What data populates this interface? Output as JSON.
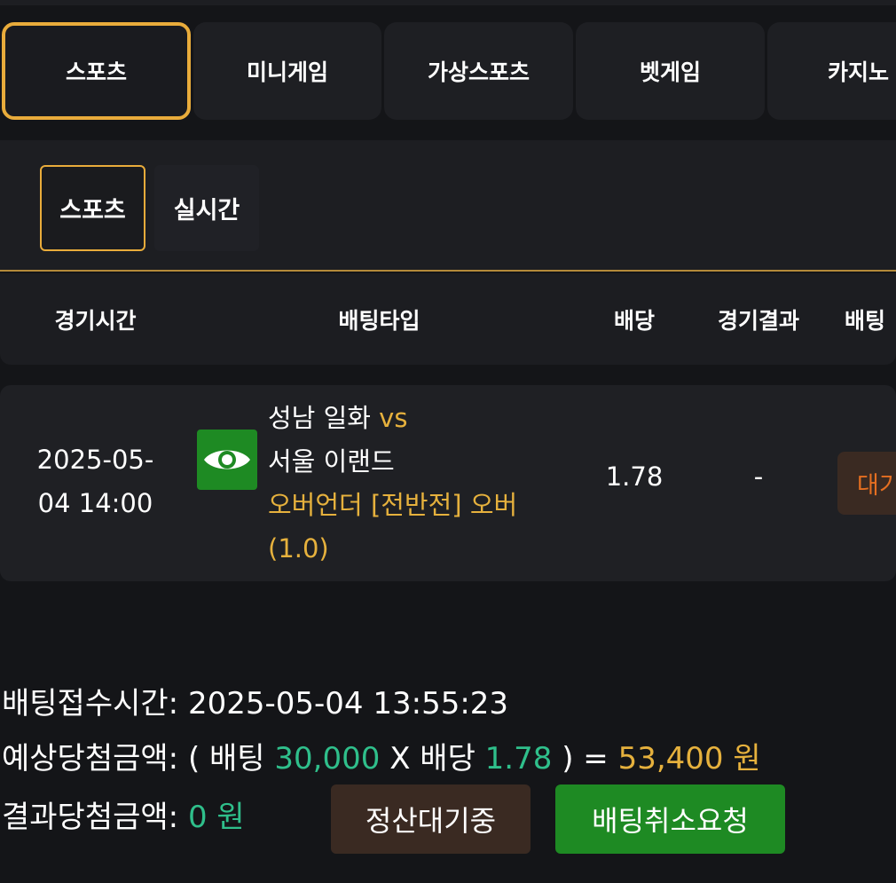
{
  "category_tabs": [
    {
      "label": "스포츠",
      "active": true
    },
    {
      "label": "미니게임",
      "active": false
    },
    {
      "label": "가상스포츠",
      "active": false
    },
    {
      "label": "벳게임",
      "active": false
    },
    {
      "label": "카지노",
      "active": false
    }
  ],
  "sub_tabs": [
    {
      "label": "스포츠",
      "active": true
    },
    {
      "label": "실시간",
      "active": false
    }
  ],
  "table": {
    "headers": [
      "경기시간",
      "배팅타입",
      "배당",
      "경기결과",
      "배팅"
    ],
    "rows": [
      {
        "time_line1": "2025-05-",
        "time_line2": "04 14:00",
        "icon": "eye-icon",
        "home": "성남 일화",
        "vs": "vs",
        "away": "서울 이랜드",
        "bet_type": "오버언더 [전반전] 오버",
        "bet_line": "(1.0)",
        "odds": "1.78",
        "result": "-",
        "status": "대기"
      }
    ]
  },
  "summary": {
    "bet_time_label": "배팅접수시간:",
    "bet_time_value": "2025-05-04 13:55:23",
    "expected_label": "예상당첨금액:",
    "expected_open": "( 배팅",
    "bet_amount": "30,000",
    "times_label": "X 배당",
    "odds": "1.78",
    "expected_close": ") =",
    "expected_amount": "53,400 원",
    "result_label": "결과당첨금액:",
    "result_amount": "0 원"
  },
  "buttons": {
    "pending": "정산대기중",
    "cancel": "배팅취소요청"
  },
  "colors": {
    "accent": "#e9ac3b",
    "green": "#1e8a23",
    "highlight_green": "#2fbf8b",
    "status_orange": "#e56f21"
  }
}
